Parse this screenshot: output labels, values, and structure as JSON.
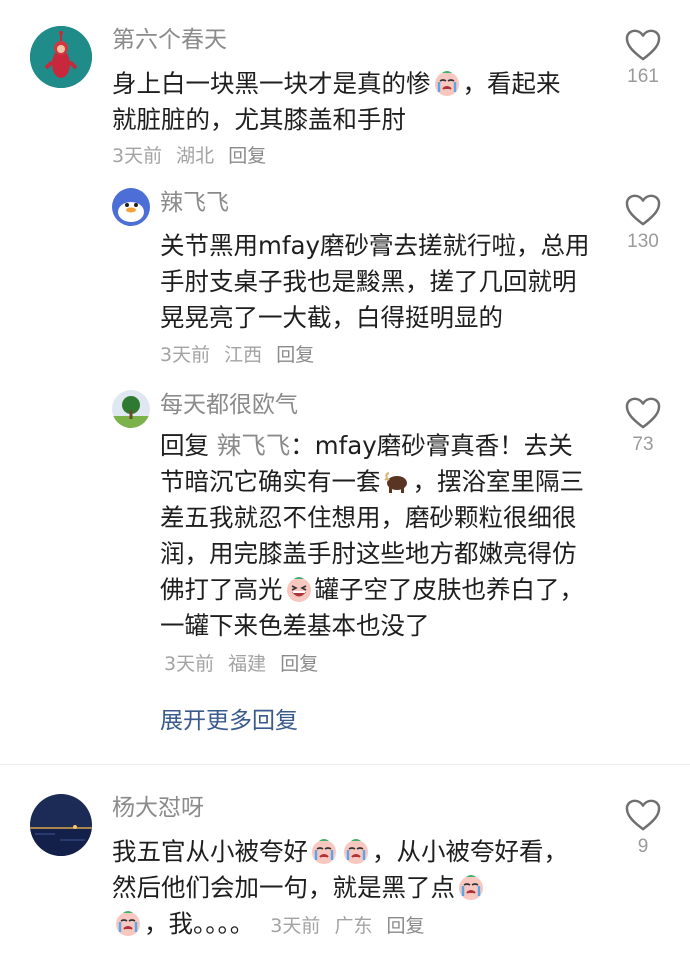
{
  "comments": [
    {
      "name": "第六个春天",
      "text_a": "身上白一块黑一块才是真的惨",
      "text_b": "，看起来就脏脏的，尤其膝盖和手肘",
      "time": "3天前",
      "location": "湖北",
      "reply_label": "回复",
      "likes": "161"
    },
    {
      "name": "辣飞飞",
      "text": "关节黑用mfay磨砂膏去搓就行啦，总用手肘支桌子我也是黢黑，搓了几回就明晃晃亮了一大截，白得挺明显的",
      "time": "3天前",
      "location": "江西",
      "reply_label": "回复",
      "likes": "130"
    },
    {
      "name": "每天都很欧气",
      "reply_prefix": "回复",
      "mention": "辣飞飞",
      "text_a": "：mfay磨砂膏真香！去关节暗沉它确实有一套",
      "text_b": "，摆浴室里隔三差五我就忍不住想用，磨砂颗粒很细很润，用完膝盖手肘这些地方都嫩亮得仿佛打了高光",
      "text_c": "罐子空了皮肤也养白了，一罐下来色差基本也没了",
      "time": "3天前",
      "location": "福建",
      "reply_label": "回复",
      "likes": "73"
    },
    {
      "name": "杨大怼呀",
      "text_a": "我五官从小被夸好",
      "text_b": "，从小被夸好看，然后他们会加一句，就是黑了点",
      "text_c": "，我。。。。",
      "time": "3天前",
      "location": "广东",
      "reply_label": "回复",
      "likes": "9"
    }
  ],
  "expand_label": "展开更多回复",
  "icons": {
    "like": "heart-outline-icon",
    "crying": "crying-face-emoji",
    "ox": "ox-emoji",
    "grin": "grinning-face-emoji"
  },
  "colors": {
    "name": "#8b8b8b",
    "meta": "#a3a3a3",
    "link": "#3a5a8c"
  }
}
